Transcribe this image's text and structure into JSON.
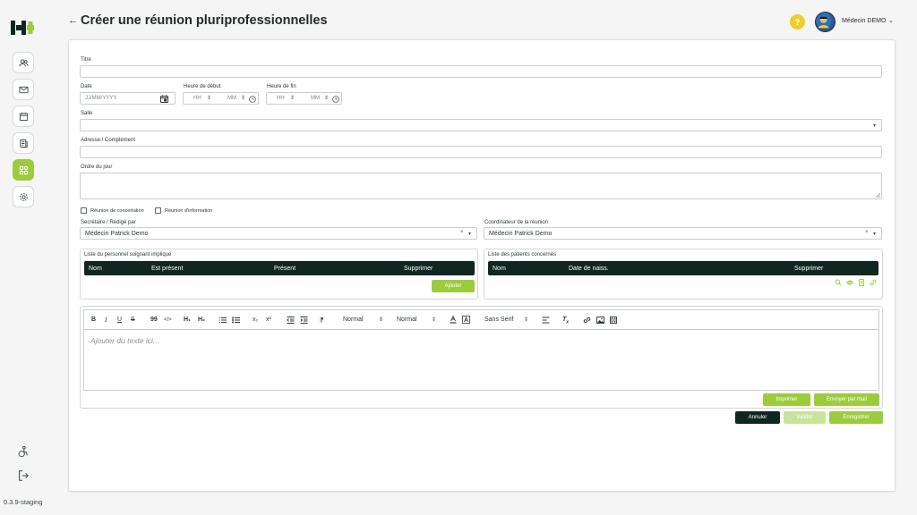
{
  "header": {
    "title": "Créer une réunion pluriprofessionnelles",
    "user_name": "Médecin DEMO"
  },
  "sidebar": {
    "items": [
      {
        "name": "users-icon"
      },
      {
        "name": "mail-icon"
      },
      {
        "name": "calendar-icon"
      },
      {
        "name": "documents-icon"
      },
      {
        "name": "grid-icon",
        "active": true
      },
      {
        "name": "settings-icon"
      }
    ],
    "version": "0.3.9-staging"
  },
  "form": {
    "titre_label": "Titre",
    "date_label": "Date",
    "date_placeholder": "JJ/MM/YYYY",
    "heure_debut_label": "Heure de début",
    "heure_fin_label": "Heure de fin",
    "hh": "HH",
    "mm": "MM",
    "salle_label": "Salle",
    "adresse_label": "Adresse / Complément",
    "ordre_label": "Ordre du jour",
    "cb_concertation": "Réunion de concertation",
    "cb_information": "Réunion d'information",
    "secretaire_label": "Secrétaire / Rédigé par",
    "secretaire_value": "Médecin Patrick Demo",
    "coordinateur_label": "Coordinateur de la réunion",
    "coordinateur_value": "Médecin Patrick Demo",
    "clear": "×"
  },
  "personnel": {
    "title": "Liste du personnel soignant impliqué",
    "columns": [
      "Nom",
      "Est présent",
      "Présent",
      "Supprimer"
    ],
    "add_button": "Ajouter"
  },
  "patients": {
    "title": "Liste des patients concernés",
    "columns": [
      "Nom",
      "Date de naiss.",
      "Supprimer"
    ]
  },
  "editor": {
    "toolbar": {
      "bold": "B",
      "italic": "I",
      "underline": "U",
      "strike": "S",
      "quote": "99",
      "code": "</>",
      "h1": "H₁",
      "h2": "H₂",
      "sub": "x₂",
      "sup": "x²",
      "size1": "Normal",
      "size2": "Normal",
      "font": "Sans Serif"
    },
    "placeholder": "Ajouter du texte ici..."
  },
  "actions": {
    "imprimer": "Imprimer",
    "envoyer": "Envoyer par mail",
    "annuler": "Annuler",
    "valider": "Valider",
    "enregistrer": "Enregistrer"
  },
  "colors": {
    "accent": "#9ccc3e",
    "dark": "#0f2720",
    "help": "#f2cc2a"
  }
}
